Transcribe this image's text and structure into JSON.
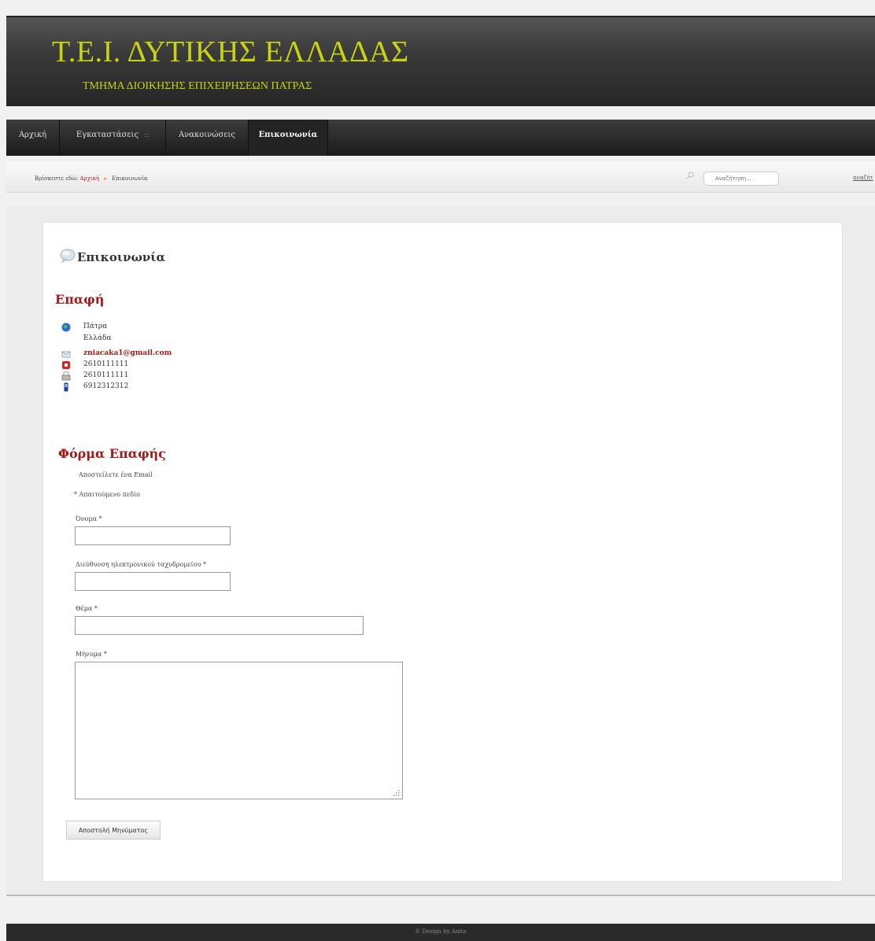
{
  "header": {
    "title": "Τ.Ε.Ι. ΔΥΤΙΚΗΣ ΕΛΛΑΔΑΣ",
    "subtitle": "ΤΜΗΜΑ ΔΙΟΙΚΗΣΗΣ ΕΠΙΧΕΙΡΗΣΕΩΝ ΠΑΤΡΑΣ",
    "title_color": "#c7d40f"
  },
  "nav": {
    "items": [
      {
        "label": "Αρχική"
      },
      {
        "label": "Εγκαταστάσεις",
        "submenu_indicator": "::"
      },
      {
        "label": "Ανακοινώσεις"
      },
      {
        "label": "Επικοινωνία",
        "active": true
      }
    ]
  },
  "breadcrumb": {
    "prefix": "Βρίσκεστε εδώ:",
    "home": "Αρχική",
    "separator": "▸",
    "current": "Επικοινωνία"
  },
  "search": {
    "placeholder": "Αναζήτηση...",
    "button_label": "αναζήτ"
  },
  "page": {
    "title": "Επικοινωνία",
    "contact_heading": "Επαφή",
    "accent_color": "#a11b1b"
  },
  "contact": {
    "city": "Πάτρα",
    "country": "Ελλάδα",
    "email": "zniacaka1@gmail.com",
    "telephone": "2610111111",
    "fax": "2610111111",
    "mobile": "6912312312"
  },
  "form": {
    "heading": "Φόρμα Επαφής",
    "intro": "Αποστείλετε ένα Email",
    "required_note": "* Απαιτούμενο πεδίο",
    "name_label": "Όνομα *",
    "name_value": "",
    "email_label": "Διεύθυνση ηλεκτρονικού ταχυδρομείου *",
    "email_value": "",
    "subject_label": "Θέμα *",
    "subject_value": "",
    "message_label": "Μήνυμα *",
    "message_value": "",
    "submit_label": "Αποστολή Μηνύματος"
  },
  "footer": {
    "text": "© Design by Anita"
  }
}
